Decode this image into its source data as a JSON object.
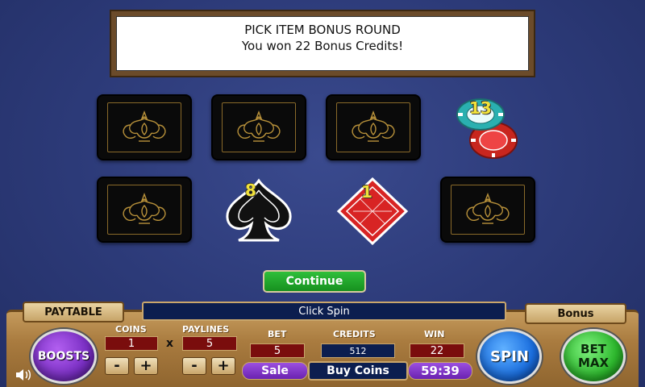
{
  "banner": {
    "line1": "PICK ITEM BONUS ROUND",
    "line2": "You won 22 Bonus Credits!"
  },
  "board": {
    "card_back_icon": "ornate-gold-crest-icon",
    "revealed": [
      {
        "id": "chips",
        "icon": "poker-chips-icon",
        "value": "13"
      },
      {
        "id": "spade",
        "icon": "spade-icon",
        "value": "8"
      },
      {
        "id": "diamond",
        "icon": "diamond-icon",
        "value": "1"
      }
    ]
  },
  "continue_label": "Continue",
  "controls": {
    "paytable_label": "PAYTABLE",
    "bonus_label": "Bonus",
    "message": "Click Spin",
    "boosts_label": "BOOSTS",
    "coins_label": "COINS",
    "coins_value": "1",
    "paylines_label": "PAYLINES",
    "paylines_value": "5",
    "times": "x",
    "minus": "-",
    "plus": "+",
    "bet_label": "BET",
    "bet_value": "5",
    "credits_label": "CREDITS",
    "credits_value": "512",
    "win_label": "WIN",
    "win_value": "22",
    "sale_label": "Sale",
    "buy_coins_label": "Buy Coins",
    "timer": "59:39",
    "spin_label": "SPIN",
    "bet_max_line1": "BET",
    "bet_max_line2": "MAX",
    "sound_icon": "speaker-icon"
  },
  "colors": {
    "background": "#2c3a78",
    "continue_green": "#1fa82a",
    "spin_blue": "#1b6fe0",
    "betmax_green": "#2db82d",
    "boosts_purple": "#7a2fc4",
    "chip_red": "#c8261e",
    "chip_teal": "#2ab0b0"
  }
}
